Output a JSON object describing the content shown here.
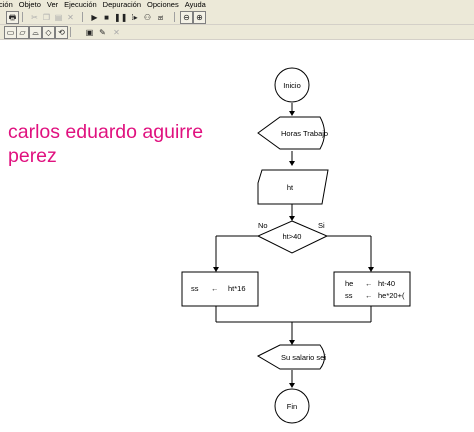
{
  "menu": {
    "items": [
      "ción",
      "Objeto",
      "Ver",
      "Ejecución",
      "Depuración",
      "Opciones",
      "Ayuda"
    ]
  },
  "toolbar1": {
    "buttons": [
      {
        "name": "print-button",
        "icon": "printer-icon",
        "glyph": "🖶"
      },
      {
        "name": "cut-button",
        "icon": "scissors-icon",
        "glyph": "✂"
      },
      {
        "name": "copy-button",
        "icon": "copy-icon",
        "glyph": "❐"
      },
      {
        "name": "paste-button",
        "icon": "paste-icon",
        "glyph": "▤"
      },
      {
        "name": "delete-button",
        "icon": "delete-x-icon",
        "glyph": "✕"
      },
      {
        "name": "run-button",
        "icon": "play-icon",
        "glyph": "▶"
      },
      {
        "name": "stop-button",
        "icon": "stop-icon",
        "glyph": "■"
      },
      {
        "name": "pause-button",
        "icon": "pause-icon",
        "glyph": "❚❚"
      },
      {
        "name": "step-button",
        "icon": "step-icon",
        "glyph": "⁞▸"
      },
      {
        "name": "trace-button",
        "icon": "footsteps-icon",
        "glyph": "⚇"
      },
      {
        "name": "variables-button",
        "icon": "variables-icon",
        "glyph": "ಹ"
      },
      {
        "name": "zoom-out-button",
        "icon": "zoom-out-icon",
        "glyph": "⊖"
      },
      {
        "name": "zoom-in-button",
        "icon": "zoom-in-icon",
        "glyph": "⊕"
      }
    ]
  },
  "toolbar2": {
    "buttons": [
      {
        "name": "assign-tool-button",
        "icon": "assignment-block-icon",
        "glyph": "▭"
      },
      {
        "name": "input-tool-button",
        "icon": "input-parallelogram-icon",
        "glyph": "▱"
      },
      {
        "name": "output-tool-button",
        "icon": "output-display-icon",
        "glyph": "⌓"
      },
      {
        "name": "decision-tool-button",
        "icon": "decision-icon",
        "glyph": "◇"
      },
      {
        "name": "loop-tool-button",
        "icon": "loop-icon",
        "glyph": "⟲"
      },
      {
        "name": "call-tool-button",
        "icon": "procedure-icon",
        "glyph": "▣"
      },
      {
        "name": "comment-tool-button",
        "icon": "comment-icon",
        "glyph": "✎"
      },
      {
        "name": "delete-tool-button",
        "icon": "delete-block-icon",
        "glyph": "✕"
      }
    ]
  },
  "author": {
    "line1": "carlos eduardo aguirre",
    "line2": "perez"
  },
  "flowchart": {
    "start_label": "Inicio",
    "output1_label": "Horas Trabajo",
    "input_label": "ht",
    "decision_label": "ht>40",
    "no_label": "No",
    "yes_label": "Si",
    "left_assign": {
      "var": "ss",
      "arrow": "←",
      "expr": "ht*16"
    },
    "right_assign": [
      {
        "var": "he",
        "arrow": "←",
        "expr": "ht-40"
      },
      {
        "var": "ss",
        "arrow": "←",
        "expr": "he*20+("
      }
    ],
    "output2_label": "Su salario sei",
    "end_label": "Fin"
  },
  "colors": {
    "author_text": "#e0117f",
    "toolbar_bg": "#ece9d8",
    "line": "#000000"
  }
}
